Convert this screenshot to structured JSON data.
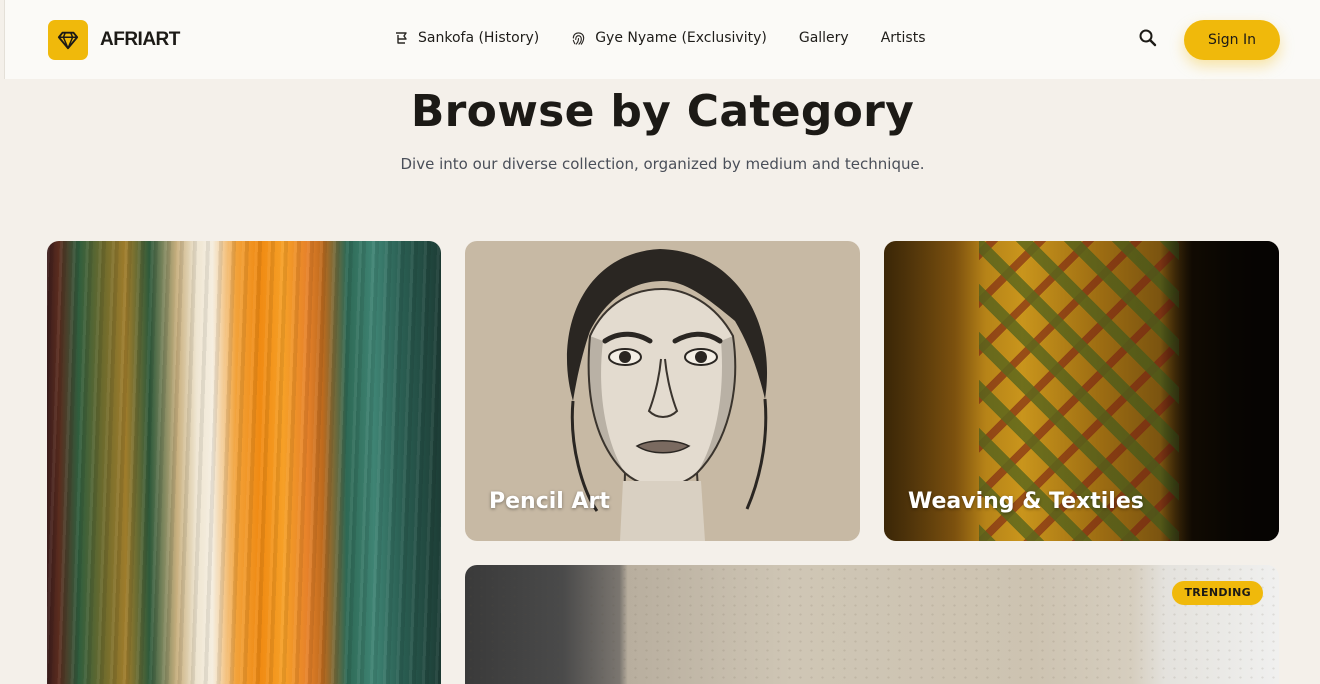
{
  "brand": {
    "name": "AFRIART",
    "accent": "#f0b90b",
    "logo_icon": "diamond-icon"
  },
  "nav": {
    "items": [
      {
        "label": "Sankofa (History)",
        "icon": "sankofa-icon"
      },
      {
        "label": "Gye Nyame (Exclusivity)",
        "icon": "fingerprint-icon"
      },
      {
        "label": "Gallery"
      },
      {
        "label": "Artists"
      }
    ]
  },
  "header": {
    "search_icon": "search-icon",
    "signin_label": "Sign In"
  },
  "section": {
    "title": "Browse by Category",
    "subtitle": "Dive into our diverse collection, organized by medium and technique."
  },
  "categories": [
    {
      "label": "",
      "image": "abstract-paint-texture"
    },
    {
      "label": "Pencil Art",
      "image": "pencil-portrait"
    },
    {
      "label": "Weaving & Textiles",
      "image": "woven-textile"
    },
    {
      "label": "",
      "image": "canvas-texture",
      "badge": "TRENDING"
    }
  ]
}
